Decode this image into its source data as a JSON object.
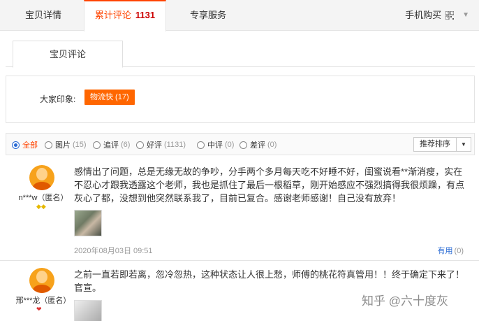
{
  "tabs": {
    "detail": "宝贝详情",
    "reviews_label": "累计评论",
    "reviews_count": "1131",
    "services": "专享服务",
    "mobile_buy": "手机购买"
  },
  "subtab": "宝贝评论",
  "impression": {
    "label": "大家印象:",
    "tag": "物流快 (17)"
  },
  "filters": [
    {
      "label": "全部",
      "count": "",
      "selected": true
    },
    {
      "label": "图片",
      "count": "(15)"
    },
    {
      "label": "追评",
      "count": "(6)"
    },
    {
      "label": "好评",
      "count": "(1131)"
    },
    {
      "label": "中评",
      "count": "(0)"
    },
    {
      "label": "差评",
      "count": "(0)"
    }
  ],
  "sort": {
    "label": "推荐排序"
  },
  "reviews": [
    {
      "user": "n***w（匿名）",
      "text": "感情出了问题，总是无缘无故的争吵，分手两个多月每天吃不好睡不好，闺蜜说看**渐消瘦，实在不忍心才跟我透露这个老师，我也是抓住了最后一根稻草，刚开始感应不强烈搞得我很烦躁，有点灰心了都，没想到他突然联系我了，目前已复合。感谢老师感谢！自己没有放弃！",
      "date": "2020年08月03日 09:51",
      "useful": "有用",
      "useful_count": "(0)"
    },
    {
      "user": "邢***龙（匿名）",
      "text": "之前一直若即若离，忽冷忽热，这种状态让人很上愁，师傅的桃花符真管用！！终于确定下来了！官宣。"
    }
  ],
  "watermark": "知乎 @六十度灰"
}
